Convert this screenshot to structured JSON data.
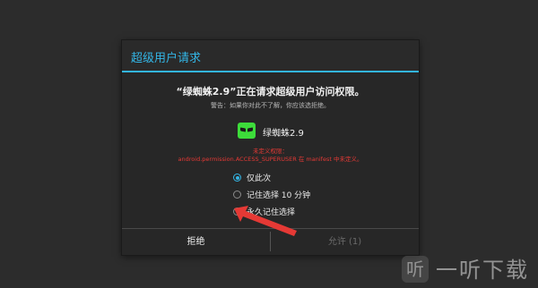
{
  "dialog": {
    "title": "超级用户请求",
    "message": "“绿蜘蛛2.9”正在请求超级用户访问权限。",
    "warning": "警告：如果你对此不了解，你应该选拒绝。",
    "app": {
      "name": "绿蜘蛛2.9",
      "icon": "spider-app-icon"
    },
    "permission_line1": "未定义权限：",
    "permission_line2": "android.permission.ACCESS_SUPERUSER 在 manifest 中未定义。",
    "options": [
      {
        "label": "仅此次",
        "selected": true
      },
      {
        "label": "记住选择 10 分钟",
        "selected": false
      },
      {
        "label": "永久记住选择",
        "selected": false
      }
    ],
    "buttons": {
      "deny": "拒绝",
      "allow": "允许 (1)"
    }
  },
  "watermark": {
    "logo": "听",
    "text": "一听下载"
  },
  "colors": {
    "accent": "#33b5e5",
    "warning": "#e53935",
    "annotation_arrow": "#e53935"
  }
}
